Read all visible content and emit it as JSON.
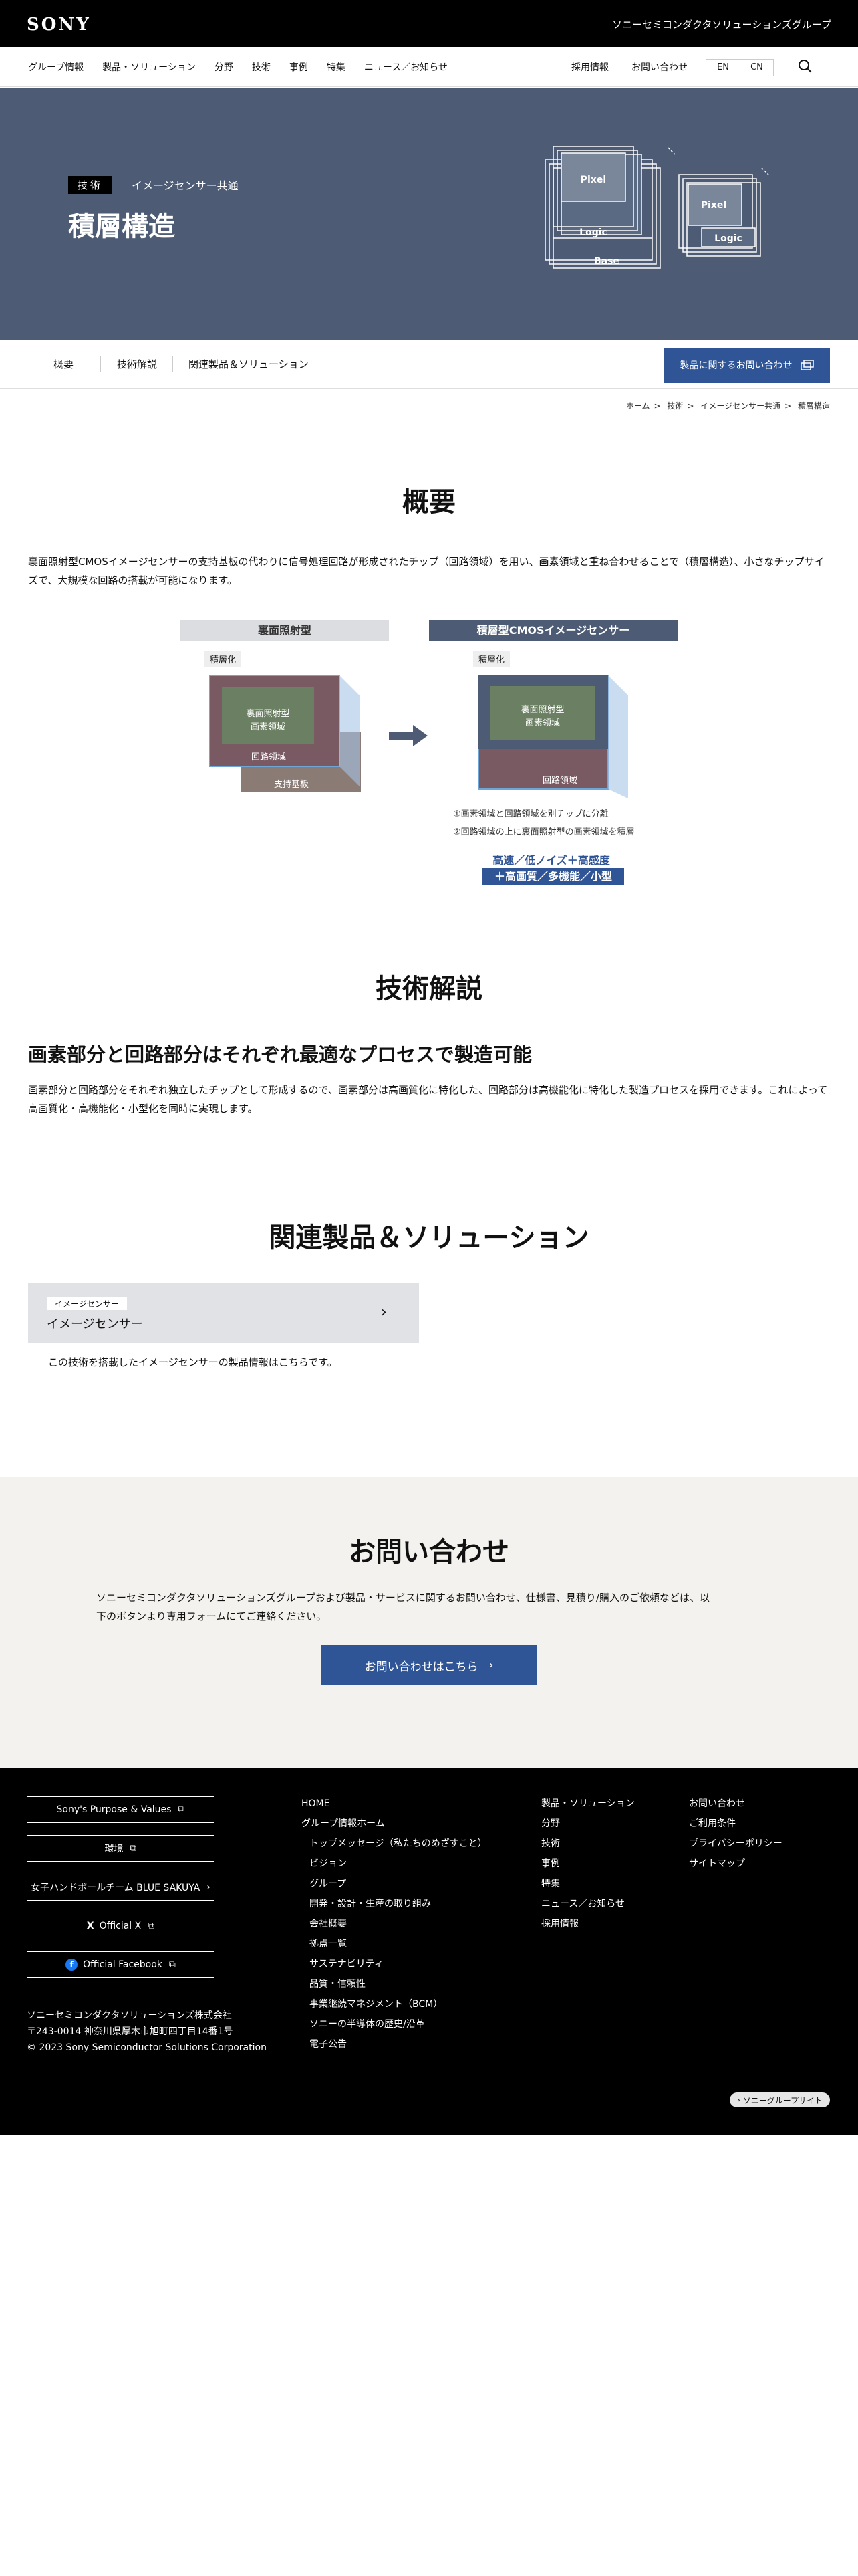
{
  "header": {
    "logo": "SONY",
    "group_name": "ソニーセミコンダクタソリューションズグループ"
  },
  "nav": {
    "items": [
      "グループ情報",
      "製品・ソリューション",
      "分野",
      "技術",
      "事例",
      "特集",
      "ニュース／お知らせ"
    ],
    "right": [
      "採用情報",
      "お問い合わせ"
    ],
    "lang": [
      "EN",
      "CN"
    ]
  },
  "hero": {
    "tag": "技術",
    "subtitle": "イメージセンサー共通",
    "title": "積層構造",
    "graphic_labels": {
      "pixel": "Pixel",
      "logic": "Logic",
      "base": "Base"
    }
  },
  "tabs": [
    "概要",
    "技術解説",
    "関連製品＆ソリューション"
  ],
  "cta_label": "製品に関するお問い合わせ",
  "breadcrumb": [
    "ホーム",
    "技術",
    "イメージセンサー共通",
    "積層構造"
  ],
  "overview": {
    "title": "概要",
    "text": "裏面照射型CMOSイメージセンサーの支持基板の代わりに信号処理回路が形成されたチップ（回路領域）を用い、画素領域と重ね合わせることで（積層構造）、小さなチップサイズで、大規模な回路の搭載が可能になります。"
  },
  "diagram": {
    "left_title": "裏面照射型",
    "right_title": "積層型CMOSイメージセンサー",
    "badge": "積層化",
    "pixel_line1": "裏面照射型",
    "pixel_line2": "画素領域",
    "circuit": "回路領域",
    "support": "支持基板",
    "note1": "①画素領域と回路領域を別チップに分離",
    "note2": "②回路領域の上に裏面照射型の画素領域を積層",
    "feature1": "高速／低ノイズ＋高感度",
    "feature2": "＋高画質／多機能／小型"
  },
  "tech": {
    "title": "技術解説",
    "subtitle": "画素部分と回路部分はそれぞれ最適なプロセスで製造可能",
    "text": "画素部分と回路部分をそれぞれ独立したチップとして形成するので、画素部分は高画質化に特化した、回路部分は高機能化に特化した製造プロセスを採用できます。これによって高画質化・高機能化・小型化を同時に実現します。"
  },
  "related": {
    "title": "関連製品＆ソリューション",
    "card_tag": "イメージセンサー",
    "card_title": "イメージセンサー",
    "card_desc": "この技術を搭載したイメージセンサーの製品情報はこちらです。"
  },
  "contact": {
    "title": "お問い合わせ",
    "text1": "ソニーセミコンダクタソリューションズグループおよび製品・サービスに関するお問い合わせ、仕様書、見積り/購入のご依頼などは、以",
    "text2": "下のボタンより専用フォームにてご連絡ください。",
    "button": "お問い合わせはこちら"
  },
  "footer": {
    "buttons": [
      "Sony's Purpose & Values",
      "環境",
      "女子ハンドボールチーム BLUE SAKUYA",
      "Official X",
      "Official Facebook"
    ],
    "col1": [
      "HOME",
      "グループ情報ホーム"
    ],
    "col1_sub": [
      "トップメッセージ（私たちのめざすこと）",
      "ビジョン",
      "グループ",
      "開発・設計・生産の取り組み",
      "会社概要",
      "拠点一覧",
      "サステナビリティ",
      "品質・信頼性",
      "事業継続マネジメント（BCM）",
      "ソニーの半導体の歴史/沿革",
      "電子公告"
    ],
    "col2": [
      "製品・ソリューション",
      "分野",
      "技術",
      "事例",
      "特集",
      "ニュース／お知らせ",
      "採用情報"
    ],
    "col3": [
      "お問い合わせ",
      "ご利用条件",
      "プライバシーポリシー",
      "サイトマップ"
    ],
    "company": "ソニーセミコンダクタソリューションズ株式会社",
    "address": "〒243-0014 神奈川県厚木市旭町四丁目14番1号",
    "copyright": "© 2023 Sony Semiconductor Solutions Corporation",
    "group_site": "ソニーグループサイト"
  },
  "colors": {
    "hero_bg": "#4d5c74",
    "accent": "#2f5597",
    "contact_bg": "#f3f2ee",
    "footer_bg": "#000000"
  }
}
